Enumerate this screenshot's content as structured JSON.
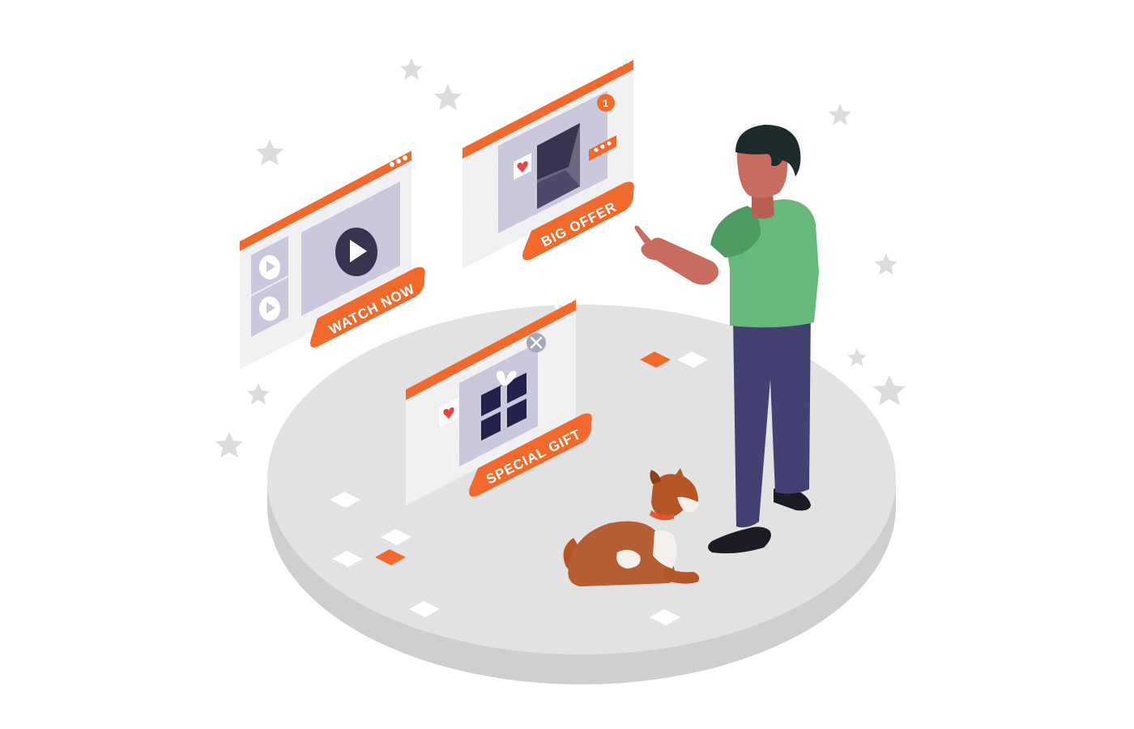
{
  "cards": {
    "watch": {
      "label": "WATCH NOW",
      "icon": "play-icon"
    },
    "offer": {
      "label": "BIG OFFER",
      "icon": "envelope-icon",
      "badge": "1"
    },
    "gift": {
      "label": "SPECIAL GIFT",
      "icon": "gift-icon"
    }
  },
  "colors": {
    "accent": "#f26a2b",
    "window": "#f4f4f6",
    "panel": "#c9c8dd",
    "dark": "#37344f",
    "platform": "#e3e3e3",
    "shirt": "#5fb877",
    "pants": "#36356a",
    "skin": "#c96d60",
    "hair": "#1e2b2b",
    "dog": "#b65526"
  }
}
